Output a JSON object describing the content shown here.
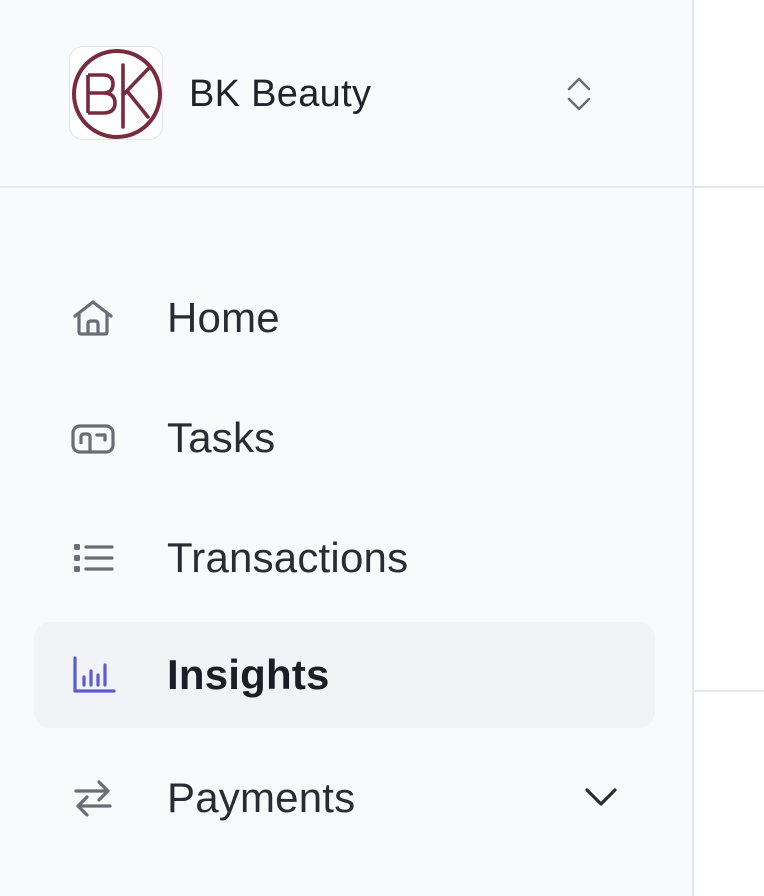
{
  "org": {
    "name": "BK Beauty",
    "logo_text": "BK",
    "logo_color": "#7a2a3d",
    "switch_icon": "chevron-up-down-icon"
  },
  "nav": {
    "items": [
      {
        "label": "Home",
        "icon": "home-icon",
        "active": false
      },
      {
        "label": "Tasks",
        "icon": "inbox-icon",
        "active": false
      },
      {
        "label": "Transactions",
        "icon": "list-icon",
        "active": false
      },
      {
        "label": "Insights",
        "icon": "bar-chart-icon",
        "active": true
      },
      {
        "label": "Payments",
        "icon": "arrows-swap-icon",
        "active": false,
        "expandable": true
      }
    ]
  },
  "colors": {
    "accent": "#5b5bd6",
    "sidebar_bg": "#f9fafc",
    "active_bg": "#f2f3f6",
    "icon_gray": "#6b6d76",
    "text": "#2b2c33"
  }
}
